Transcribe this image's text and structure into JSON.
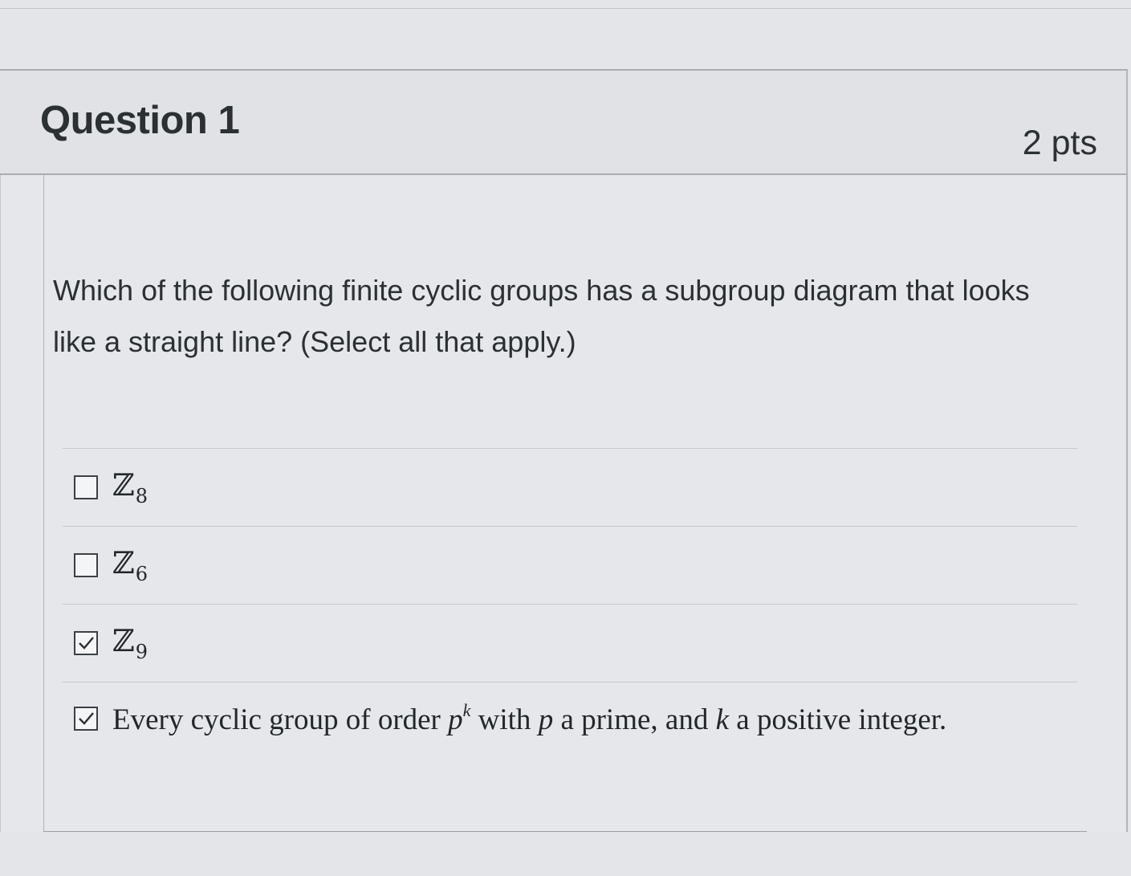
{
  "question": {
    "title": "Question 1",
    "points": "2 pts",
    "text": "Which of the following finite cyclic groups has a subgroup diagram that looks like a straight line? (Select all that apply.)"
  },
  "answers": [
    {
      "symbol": "ℤ",
      "subscript": "8",
      "checked": false
    },
    {
      "symbol": "ℤ",
      "subscript": "6",
      "checked": false
    },
    {
      "symbol": "ℤ",
      "subscript": "9",
      "checked": true
    },
    {
      "checked": true,
      "parts": {
        "a": "Every cyclic group of order ",
        "p1": "p",
        "k1": "k",
        "b": " with ",
        "p2": "p",
        "c": " a prime, and ",
        "k2": "k",
        "d": " a positive integer."
      }
    }
  ],
  "icons": {
    "checkbox_checked": "checkmark-icon"
  }
}
